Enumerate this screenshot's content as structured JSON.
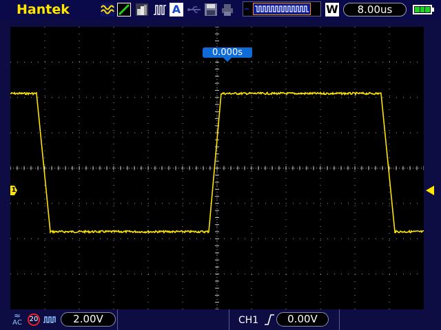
{
  "topbar": {
    "brand": "Hantek",
    "timebase": "8.00us",
    "mode_label": "W",
    "auto_label": "A",
    "icons": [
      "waveform-icon",
      "ramp-icon",
      "persistence-icon",
      "pulse-icon",
      "auto-icon",
      "usb-icon",
      "save-icon",
      "print-icon",
      "waveform-overview-icon",
      "battery-icon"
    ]
  },
  "screen": {
    "trigger_position": "0.000s",
    "channel_marker": "1",
    "background": "#000000",
    "trace_color": "#ffe600",
    "grid_color": "#c8c8c8"
  },
  "bottombar": {
    "coupling_label": "AC",
    "bw_limit_label": "20",
    "ch1_volt_div": "2.00V",
    "trigger_source": "CH1",
    "trigger_level": "0.00V"
  },
  "colors": {
    "accent": "#0f6bd7",
    "brand": "#ffe600",
    "bar": "#0d0d44"
  }
}
